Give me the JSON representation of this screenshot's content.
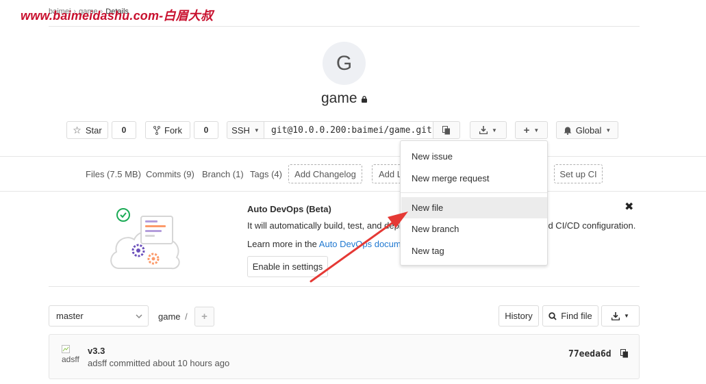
{
  "watermark": "www.baimeidashu.com-白眉大叔",
  "breadcrumb": {
    "group": "baimei",
    "project": "game",
    "current": "Details"
  },
  "project": {
    "avatar_letter": "G",
    "name": "game"
  },
  "actions": {
    "star_label": "Star",
    "star_count": "0",
    "fork_label": "Fork",
    "fork_count": "0",
    "protocol": "SSH",
    "clone_url": "git@10.0.0.200:baimei/game.git",
    "notification_label": "Global"
  },
  "nav": {
    "files": "Files (7.5 MB)",
    "commits": "Commits (9)",
    "branch": "Branch (1)",
    "tags": "Tags (4)",
    "add_changelog": "Add Changelog",
    "add_license_partial": "Add L",
    "setup_ci": "Set up CI"
  },
  "devops": {
    "title": "Auto DevOps (Beta)",
    "text": "It will automatically build, test, and deplo",
    "text_tail": "ned CI/CD configuration.",
    "learn_prefix": "Learn more in the ",
    "learn_link": "Auto DevOps docume",
    "enable_button": "Enable in settings"
  },
  "dropdown": {
    "items": [
      "New issue",
      "New merge request",
      "New file",
      "New branch",
      "New tag"
    ],
    "active": "New file"
  },
  "repo": {
    "branch": "master",
    "path": "game",
    "path_sep": "/",
    "history": "History",
    "find_file": "Find file"
  },
  "commit": {
    "avatar_alt": "adsff",
    "title": "v3.3",
    "meta": "adsff committed about 10 hours ago",
    "sha": "77eeda6d"
  },
  "colors": {
    "watermark": "#c8102e",
    "link": "#1f78d1",
    "arrow": "#e53935",
    "devops_check": "#1aaa55"
  }
}
